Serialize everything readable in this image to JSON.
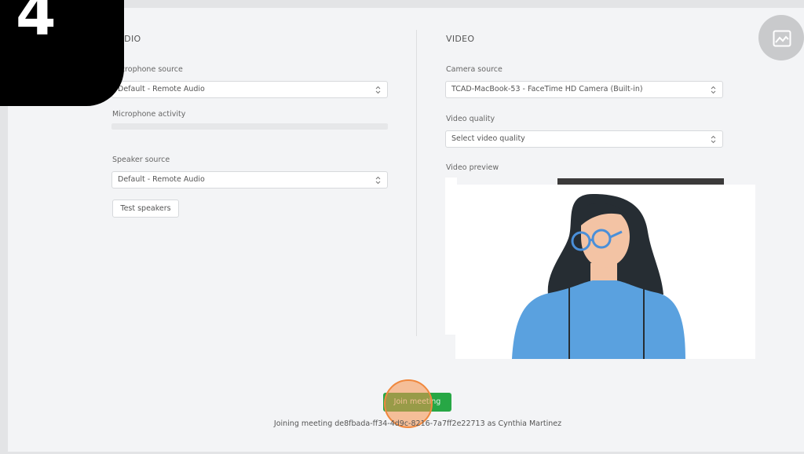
{
  "step": {
    "number": "4"
  },
  "audio": {
    "title": "AUDIO",
    "microphone_source_label": "Microphone source",
    "microphone_source_value": "Default - Remote Audio",
    "microphone_activity_label": "Microphone activity",
    "microphone_activity_level": 0,
    "speaker_source_label": "Speaker source",
    "speaker_source_value": "Default - Remote Audio",
    "test_speakers_label": "Test speakers"
  },
  "video": {
    "title": "VIDEO",
    "camera_source_label": "Camera source",
    "camera_source_value": "TCAD-MacBook-53 - FaceTime HD Camera (Built-in)",
    "video_quality_label": "Video quality",
    "video_quality_value": "Select video quality",
    "video_preview_label": "Video preview"
  },
  "footer": {
    "join_button_label": "Join meeting",
    "status_text": "Joining meeting de8fbada-ff34-4d9c-8216-7a7ff2e22713 as Cynthia Martinez"
  },
  "icons": {
    "avatar_button": "image-edit-icon",
    "select_chevron": "chevron-up-down-icon"
  },
  "colors": {
    "join_button": "#27a745",
    "click_indicator": "#f0883e",
    "step_badge": "#000000",
    "person_shirt": "#5aa1df",
    "person_hair": "#262d33",
    "person_skin": "#f3c3a4",
    "person_glasses": "#4a8fd9"
  }
}
